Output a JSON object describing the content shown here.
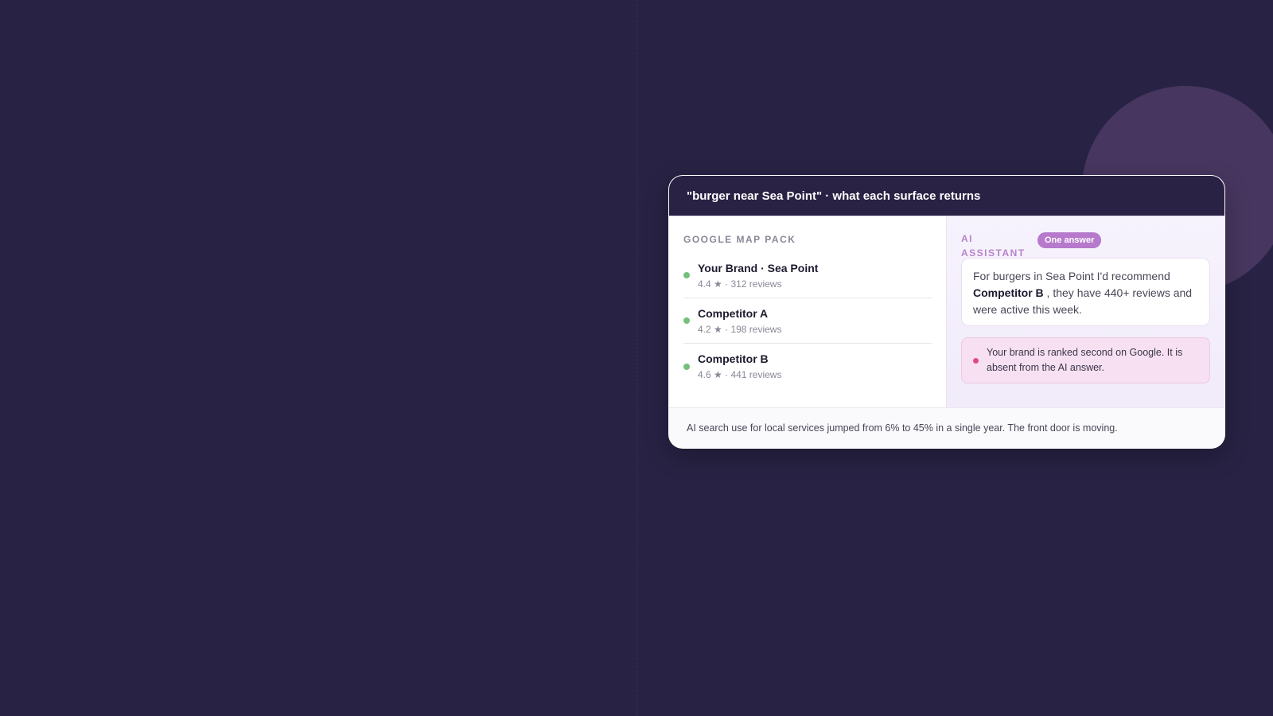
{
  "card": {
    "title": "\"burger near Sea Point\" · what each surface returns"
  },
  "map_pack": {
    "label": "GOOGLE MAP PACK",
    "items": [
      {
        "name": "Your Brand · Sea Point",
        "meta": "4.4 ★ · 312 reviews"
      },
      {
        "name": "Competitor A",
        "meta": "4.2 ★ · 198 reviews"
      },
      {
        "name": "Competitor B",
        "meta": "4.6 ★ · 441 reviews"
      }
    ]
  },
  "ai_assistant": {
    "label": "AI ASSISTANT",
    "badge": "One answer",
    "answer_pre": "For burgers in Sea Point I'd recommend ",
    "answer_bold": "Competitor B",
    "answer_post": " , they have 440+ reviews and were active this week.",
    "alert": "Your brand is ranked second on Google. It is absent from the AI answer."
  },
  "footer": {
    "text": "AI search use for local services jumped from 6% to 45% in a single year. The front door is moving."
  },
  "colors": {
    "background": "#282244",
    "status_dot": "#74c07a",
    "badge": "#b679cc",
    "alert_dot": "#e2498a"
  }
}
